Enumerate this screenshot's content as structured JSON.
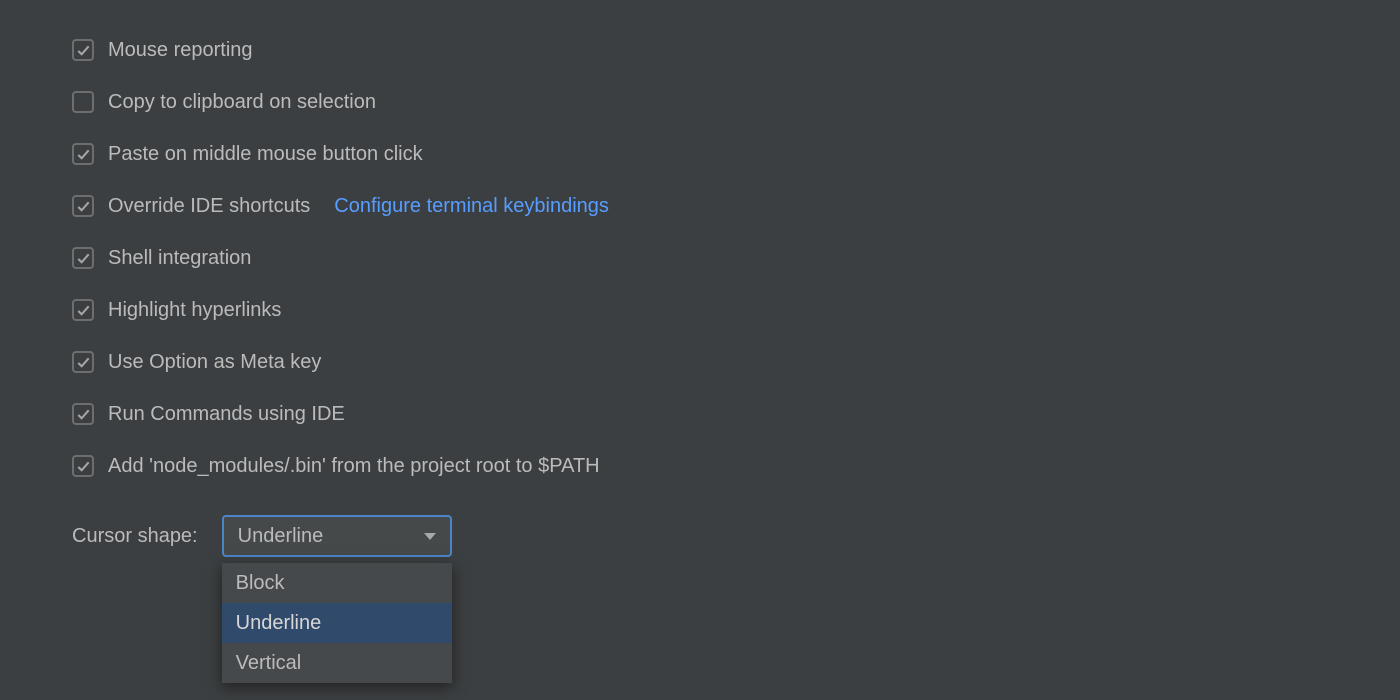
{
  "settings": {
    "checkboxes": [
      {
        "key": "mouse-reporting",
        "label": "Mouse reporting",
        "checked": true,
        "link": null
      },
      {
        "key": "copy-on-selection",
        "label": "Copy to clipboard on selection",
        "checked": false,
        "link": null
      },
      {
        "key": "paste-middle-click",
        "label": "Paste on middle mouse button click",
        "checked": true,
        "link": null
      },
      {
        "key": "override-shortcuts",
        "label": "Override IDE shortcuts",
        "checked": true,
        "link": "Configure terminal keybindings"
      },
      {
        "key": "shell-integration",
        "label": "Shell integration",
        "checked": true,
        "link": null
      },
      {
        "key": "highlight-links",
        "label": "Highlight hyperlinks",
        "checked": true,
        "link": null
      },
      {
        "key": "option-as-meta",
        "label": "Use Option as Meta key",
        "checked": true,
        "link": null
      },
      {
        "key": "run-commands-ide",
        "label": "Run Commands using IDE",
        "checked": true,
        "link": null
      },
      {
        "key": "node-modules-bin",
        "label": "Add 'node_modules/.bin' from the project root to $PATH",
        "checked": true,
        "link": null
      }
    ],
    "cursor_shape": {
      "label": "Cursor shape:",
      "value": "Underline",
      "options": [
        "Block",
        "Underline",
        "Vertical"
      ]
    }
  }
}
